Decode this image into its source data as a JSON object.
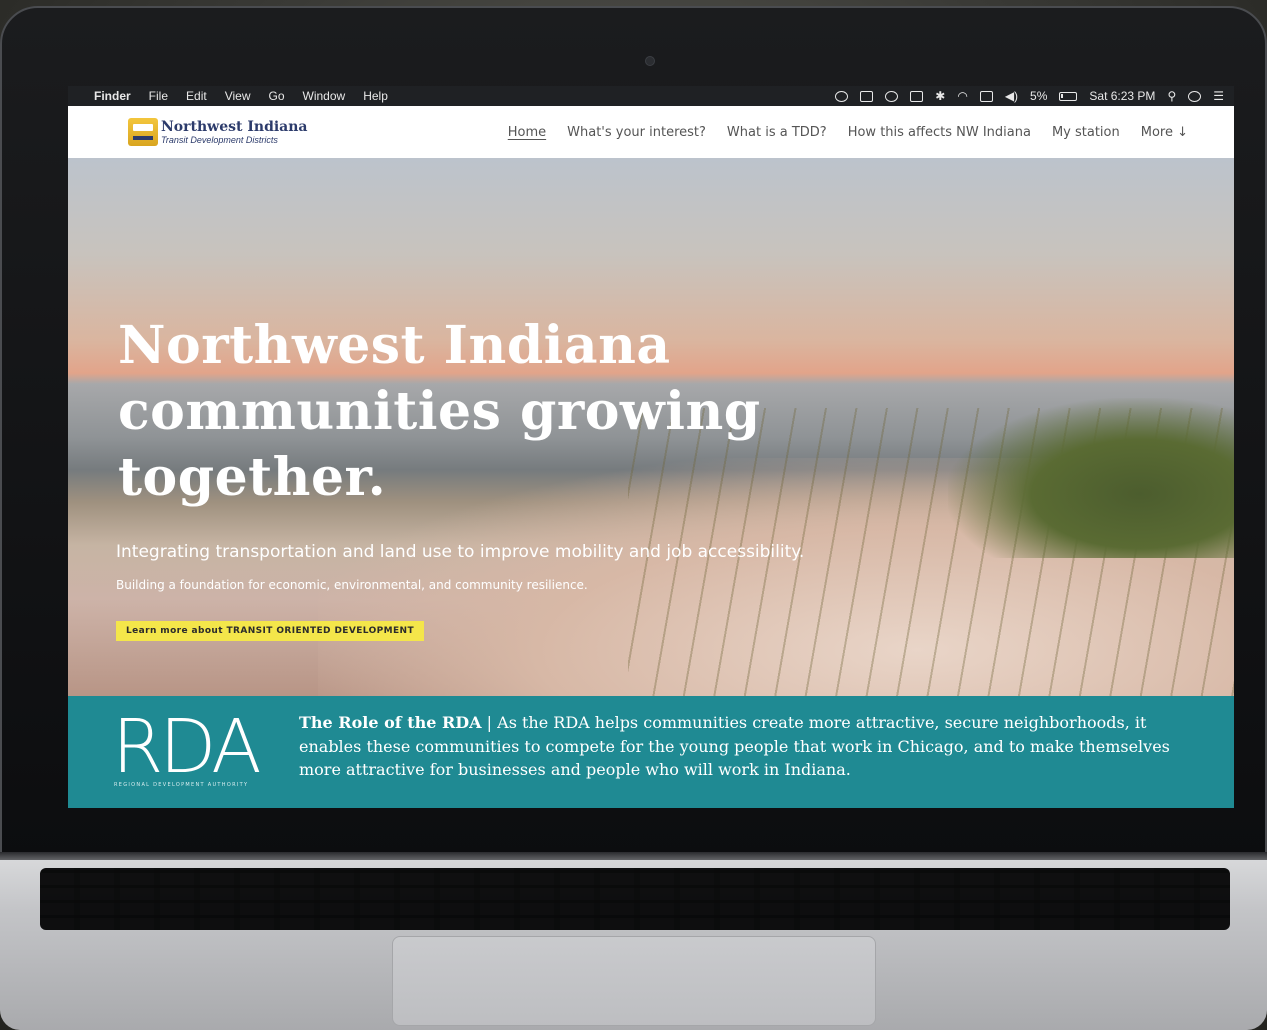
{
  "menubar": {
    "items": [
      "Finder",
      "File",
      "Edit",
      "View",
      "Go",
      "Window",
      "Help"
    ],
    "battery": "5%",
    "clock": "Sat 6:23 PM"
  },
  "site": {
    "logo_title": "Northwest Indiana",
    "logo_subtitle": "Transit Development Districts",
    "nav": [
      "Home",
      "What's your interest?",
      "What is a TDD?",
      "How this affects NW Indiana",
      "My station",
      "More ↓"
    ]
  },
  "hero": {
    "title_line1": "Northwest Indiana",
    "title_line2": "communities growing",
    "title_line3": "together.",
    "subtitle": "Integrating transportation and land use to improve mobility and job accessibility.",
    "subtitle2": "Building a foundation for economic, environmental, and community resilience.",
    "cta": "Learn more about TRANSIT ORIENTED DEVELOPMENT"
  },
  "rda": {
    "logo_text": "RDA",
    "logo_tagline": "REGIONAL DEVELOPMENT AUTHORITY",
    "lead": "The Role of the RDA",
    "separator": " | ",
    "body": "As the RDA helps communities create more attractive, secure neighborhoods, it enables these communities to compete for the young people that work in Chicago, and to make themselves more attractive for businesses and people who will work in Indiana."
  },
  "colors": {
    "teal_band": "#1f8a93",
    "cta_yellow": "#f4e64a",
    "brand_navy": "#2c3b6b",
    "logo_gold": "#f3c63d"
  }
}
